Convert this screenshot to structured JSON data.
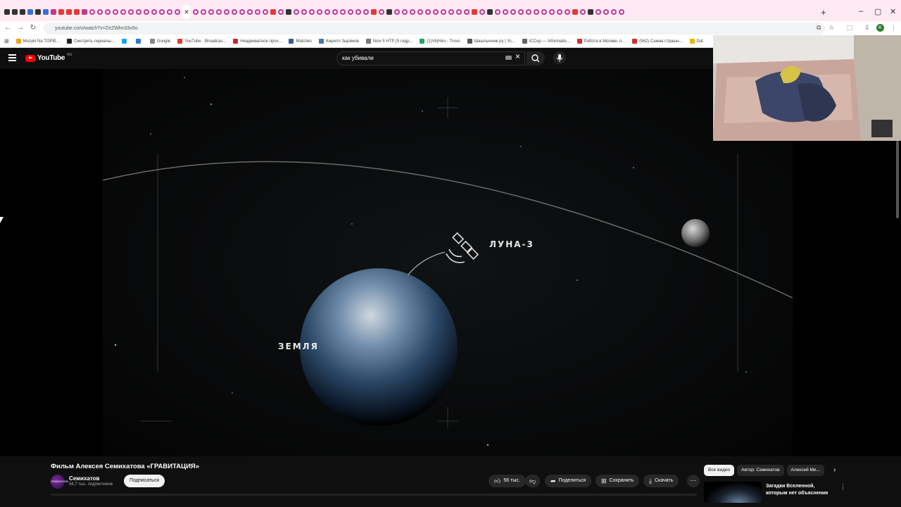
{
  "browser": {
    "url": "youtube.com/watch?v=ZeZWhn33v6o",
    "bookmarks": [
      "Muzyki Na TOPIE...",
      "Смотреть сериалы...",
      "",
      "",
      "Google",
      "YouTube · Broadcas...",
      "Неадекватное прох...",
      "Matches",
      "Кирилл Зырянов",
      "Now 5 НТР (5 гидр...",
      "(1)Vk|Hiro - Trovo",
      "Шашлычник.ру | Ус...",
      "ICCup — Informatio...",
      "Работа в Москве, п...",
      "(562) Самая страшн...",
      "Dat"
    ],
    "profile_initial": "K"
  },
  "youtube": {
    "logo": "YouTube",
    "region": "RU",
    "search_value": "как убивали"
  },
  "video": {
    "label_satellite": "ЛУНА-3",
    "label_earth": "ЗЕМЛЯ"
  },
  "info": {
    "title": "Фильм Алексея Семихатова «ГРАВИТАЦИЯ»",
    "channel_name": "Семихатов",
    "avatar_text": "СЕМИХАТОВ",
    "subscribers": "56,7 тыс. подписчиков",
    "subscribe_label": "Подписаться",
    "like_count": "56 тыс.",
    "share_label": "Поделиться",
    "save_label": "Сохранить",
    "download_label": "Скачать"
  },
  "recommendations": {
    "chips": [
      "Все видео",
      "Автор: Семихатов",
      "Алексей Ми..."
    ],
    "first_title": "Загадки Вселенной, которым нет объяснения"
  }
}
